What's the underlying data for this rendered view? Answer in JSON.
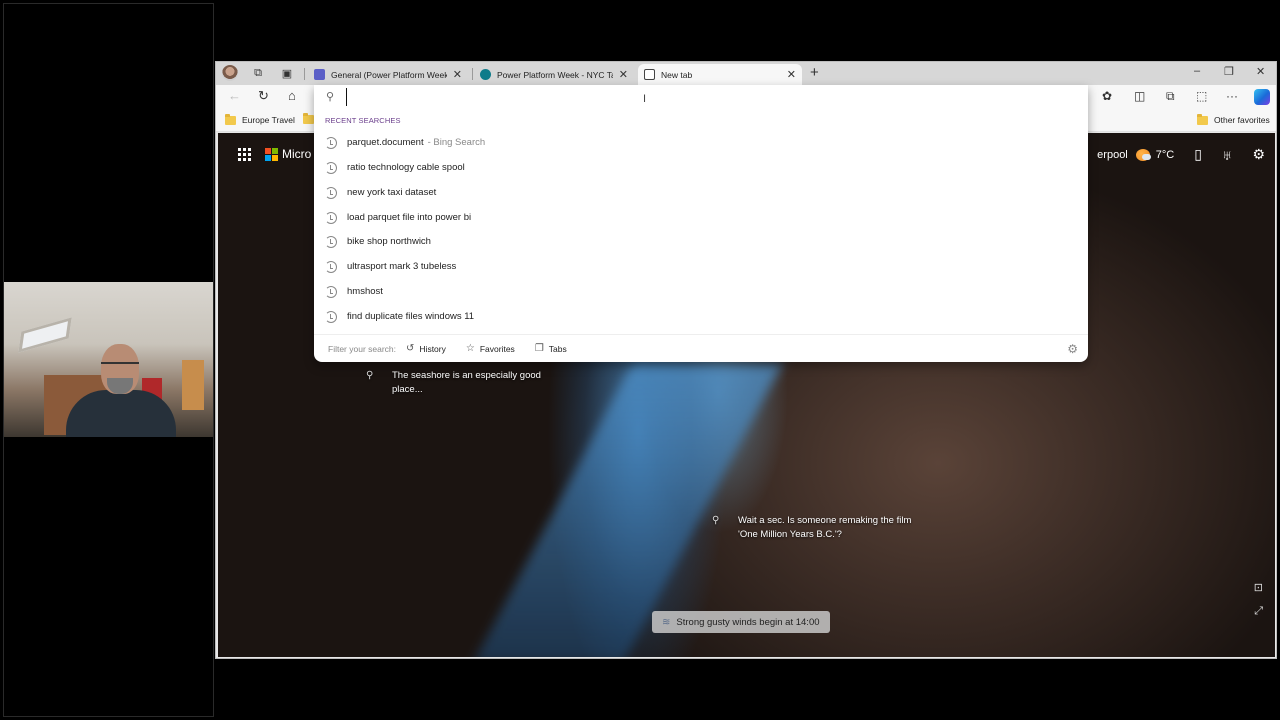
{
  "browser": {
    "tabs": [
      {
        "label": "General (Power Platform Week) |",
        "icon": "teams-icon",
        "active": false
      },
      {
        "label": "Power Platform Week - NYC Taxi",
        "icon": "sharepoint-icon",
        "active": false
      },
      {
        "label": "New tab",
        "icon": "newtab-page-icon",
        "active": true
      }
    ],
    "new_tab_symbol": "+",
    "window_controls": {
      "minimize": "–",
      "restore": "❐",
      "close": "✕"
    },
    "toolbar_icons": [
      "back-icon",
      "refresh-icon",
      "home-icon",
      "extensions-icon",
      "split-screen-icon",
      "collections-icon",
      "screenshot-icon",
      "more-icon",
      "copilot-icon"
    ],
    "favorites": [
      {
        "label": "Europe Travel"
      },
      {
        "label": ""
      }
    ],
    "other_favorites": "Other favorites"
  },
  "omnibox": {
    "value": "",
    "placeholder": "",
    "recent_header": "RECENT SEARCHES",
    "suggestions": [
      {
        "text": "parquet.document",
        "source": "- Bing Search"
      },
      {
        "text": "ratio technology cable spool",
        "source": ""
      },
      {
        "text": "new york taxi dataset",
        "source": ""
      },
      {
        "text": "load parquet file into power bi",
        "source": ""
      },
      {
        "text": "bike shop northwich",
        "source": ""
      },
      {
        "text": "ultrasport mark 3 tubeless",
        "source": ""
      },
      {
        "text": "hmshost",
        "source": ""
      },
      {
        "text": "find duplicate files windows 11",
        "source": ""
      }
    ],
    "filter_label": "Filter your search:",
    "filters": [
      {
        "label": "History",
        "icon": "history-icon"
      },
      {
        "label": "Favorites",
        "icon": "star-icon"
      },
      {
        "label": "Tabs",
        "icon": "tabs-icon"
      }
    ]
  },
  "newtab": {
    "brand_partial": "Micro",
    "location_partial": "erpool",
    "temperature": "7°C",
    "hotspots": [
      {
        "text_line1": "The seashore is an especially good",
        "text_line2": "place..."
      },
      {
        "text_line1": "Wait a sec. Is someone remaking the film",
        "text_line2": "'One Million Years B.C.'?"
      }
    ],
    "weather_alert": "Strong gusty winds begin at 14:00"
  }
}
